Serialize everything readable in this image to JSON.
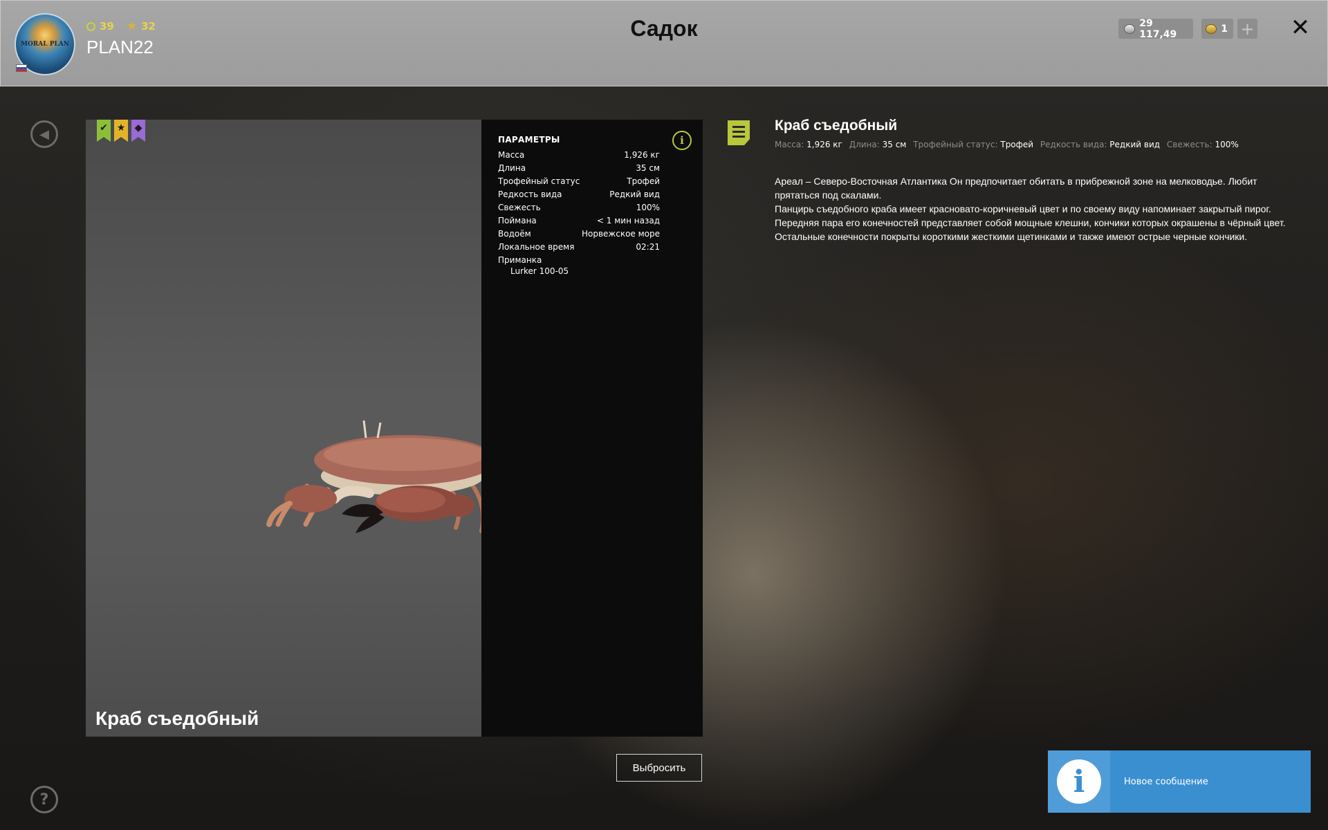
{
  "header": {
    "title": "Садок",
    "player": {
      "name": "PLAN22",
      "level": "39",
      "rank": "32",
      "avatar_text": "MORAL PLAN",
      "flag": "russia-flag-icon"
    },
    "currency": {
      "silver": "29 117,49",
      "gold": "1"
    },
    "add_label": "+",
    "close_label": "✕"
  },
  "colors": {
    "header_bg": "#a0a0a0",
    "accent_lime": "#b8c73c",
    "toast_blue": "#3a8fd1",
    "ribbon_green": "#8bbf3a",
    "ribbon_yellow": "#e2b42a",
    "ribbon_purple": "#9a6ad6"
  },
  "viewer": {
    "fish_name": "Краб съедобный",
    "ribbons": [
      "check-icon",
      "star-icon",
      "diamond-icon"
    ]
  },
  "params": {
    "title": "ПАРАМЕТРЫ",
    "rows": [
      {
        "label": "Масса",
        "value": "1,926 кг"
      },
      {
        "label": "Длина",
        "value": "35 см"
      },
      {
        "label": "Трофейный статус",
        "value": "Трофей"
      },
      {
        "label": "Редкость вида",
        "value": "Редкий вид"
      },
      {
        "label": "Свежесть",
        "value": "100%"
      },
      {
        "label": "Поймана",
        "value": "< 1 мин назад"
      },
      {
        "label": "Водоём",
        "value": "Норвежское море"
      },
      {
        "label": "Локальное время",
        "value": "02:21"
      }
    ],
    "bait_label": "Приманка",
    "bait_value": "Lurker 100-05"
  },
  "description": {
    "title": "Краб съедобный",
    "meta": [
      {
        "label": "Масса:",
        "value": "1,926 кг"
      },
      {
        "label": "Длина:",
        "value": "35 см"
      },
      {
        "label": "Трофейный статус:",
        "value": "Трофей"
      },
      {
        "label": "Редкость вида:",
        "value": "Редкий вид"
      },
      {
        "label": "Свежесть:",
        "value": "100%"
      }
    ],
    "paragraphs": [
      "Ареал – Северо-Восточная Атлантика Он предпочитает обитать в прибрежной зоне на мелководье. Любит прятаться под скалами.",
      "Панцирь съедобного краба имеет красновато-коричневый цвет и по своему виду напоминает закрытый пирог. Передняя пара его конечностей представляет собой мощные клешни, кончики которых окрашены в чёрный цвет. Остальные конечности покрыты короткими жесткими щетинками и также имеют острые черные кончики."
    ]
  },
  "actions": {
    "discard_label": "Выбросить"
  },
  "toast": {
    "text": "Новое сообщение"
  }
}
